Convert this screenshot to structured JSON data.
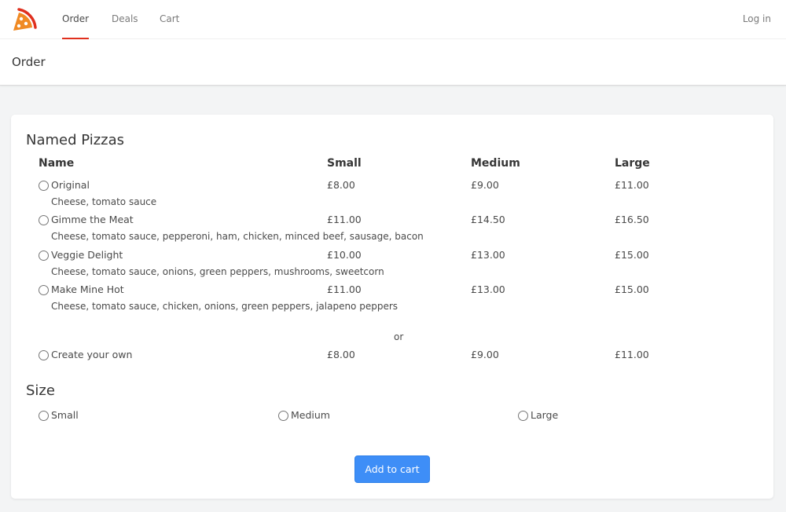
{
  "nav": {
    "logo_icon": "pizza-slice-icon",
    "accent_color": "#e0301e",
    "tabs": [
      {
        "label": "Order",
        "active": true
      },
      {
        "label": "Deals",
        "active": false
      },
      {
        "label": "Cart",
        "active": false
      }
    ],
    "login_label": "Log in"
  },
  "page": {
    "title": "Order"
  },
  "named_pizzas": {
    "title": "Named Pizzas",
    "columns": [
      "Name",
      "Small",
      "Medium",
      "Large"
    ],
    "rows": [
      {
        "name": "Original",
        "small": "£8.00",
        "medium": "£9.00",
        "large": "£11.00",
        "toppings": "Cheese, tomato sauce"
      },
      {
        "name": "Gimme the Meat",
        "small": "£11.00",
        "medium": "£14.50",
        "large": "£16.50",
        "toppings": "Cheese, tomato sauce, pepperoni, ham, chicken, minced beef, sausage, bacon"
      },
      {
        "name": "Veggie Delight",
        "small": "£10.00",
        "medium": "£13.00",
        "large": "£15.00",
        "toppings": "Cheese, tomato sauce, onions, green peppers, mushrooms, sweetcorn"
      },
      {
        "name": "Make Mine Hot",
        "small": "£11.00",
        "medium": "£13.00",
        "large": "£15.00",
        "toppings": "Cheese, tomato sauce, chicken, onions, green peppers, jalapeno peppers"
      }
    ],
    "or_label": "or",
    "custom": {
      "name": "Create your own",
      "small": "£8.00",
      "medium": "£9.00",
      "large": "£11.00"
    }
  },
  "size": {
    "title": "Size",
    "options": [
      "Small",
      "Medium",
      "Large"
    ]
  },
  "actions": {
    "add_to_cart": "Add to cart",
    "button_color": "#3e8ef7"
  }
}
